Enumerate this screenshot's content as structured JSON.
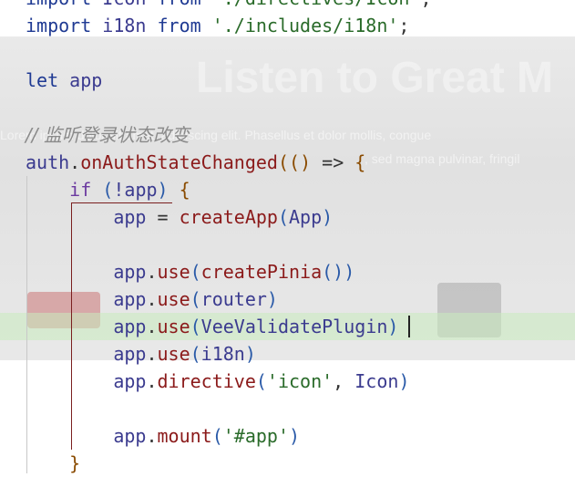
{
  "background": {
    "headline": "Listen to Great M",
    "subtitle_line1": "Lorem ipsum dolor sit amet, adipiscing elit. Phasellus et dolor mollis, congue",
    "subtitle_line2": ", sed magna pulvinar, fringil"
  },
  "code_lines": [
    {
      "tokens": [
        {
          "t": "import",
          "c": "kw"
        },
        {
          "t": " Icon ",
          "c": "ident"
        },
        {
          "t": "from",
          "c": "kw"
        },
        {
          "t": " ",
          "c": "op"
        },
        {
          "t": "'./directives/Icon'",
          "c": "str"
        },
        {
          "t": ";",
          "c": "op"
        }
      ]
    },
    {
      "tokens": [
        {
          "t": "import",
          "c": "kw"
        },
        {
          "t": " i18n ",
          "c": "ident"
        },
        {
          "t": "from",
          "c": "kw"
        },
        {
          "t": " ",
          "c": "op"
        },
        {
          "t": "'./includes/i18n'",
          "c": "str"
        },
        {
          "t": ";",
          "c": "op"
        }
      ]
    },
    {
      "tokens": []
    },
    {
      "tokens": [
        {
          "t": "let",
          "c": "kw"
        },
        {
          "t": " app",
          "c": "ident"
        }
      ]
    },
    {
      "tokens": []
    },
    {
      "tokens": [
        {
          "t": "// 监听登录状态改变",
          "c": "cmt"
        }
      ]
    },
    {
      "tokens": [
        {
          "t": "auth",
          "c": "ident"
        },
        {
          "t": ".",
          "c": "op"
        },
        {
          "t": "onAuthStateChanged",
          "c": "fn"
        },
        {
          "t": "((",
          "c": "paren"
        },
        {
          "t": ")",
          "c": "paren"
        },
        {
          "t": " => ",
          "c": "op"
        },
        {
          "t": "{",
          "c": "paren"
        }
      ]
    },
    {
      "tokens": [
        {
          "t": "    ",
          "c": "op"
        },
        {
          "t": "if",
          "c": "kw2"
        },
        {
          "t": " (",
          "c": "paren2"
        },
        {
          "t": "!app",
          "c": "ident"
        },
        {
          "t": ")",
          "c": "paren2"
        },
        {
          "t": " {",
          "c": "paren"
        }
      ]
    },
    {
      "tokens": [
        {
          "t": "        ",
          "c": "op"
        },
        {
          "t": "app",
          "c": "ident"
        },
        {
          "t": " = ",
          "c": "op"
        },
        {
          "t": "createApp",
          "c": "fn"
        },
        {
          "t": "(",
          "c": "paren2"
        },
        {
          "t": "App",
          "c": "ident"
        },
        {
          "t": ")",
          "c": "paren2"
        }
      ]
    },
    {
      "tokens": []
    },
    {
      "tokens": [
        {
          "t": "        ",
          "c": "op"
        },
        {
          "t": "app",
          "c": "ident"
        },
        {
          "t": ".",
          "c": "op"
        },
        {
          "t": "use",
          "c": "fn"
        },
        {
          "t": "(",
          "c": "paren2"
        },
        {
          "t": "createPinia",
          "c": "fn"
        },
        {
          "t": "())",
          "c": "paren2"
        }
      ]
    },
    {
      "tokens": [
        {
          "t": "        ",
          "c": "op"
        },
        {
          "t": "app",
          "c": "ident"
        },
        {
          "t": ".",
          "c": "op"
        },
        {
          "t": "use",
          "c": "fn"
        },
        {
          "t": "(",
          "c": "paren2"
        },
        {
          "t": "router",
          "c": "ident"
        },
        {
          "t": ")",
          "c": "paren2"
        }
      ]
    },
    {
      "tokens": [
        {
          "t": "        ",
          "c": "op"
        },
        {
          "t": "app",
          "c": "ident"
        },
        {
          "t": ".",
          "c": "op"
        },
        {
          "t": "use",
          "c": "fn"
        },
        {
          "t": "(",
          "c": "paren2"
        },
        {
          "t": "VeeValidatePlugin",
          "c": "ident"
        },
        {
          "t": ")",
          "c": "paren2"
        }
      ],
      "highlight": true
    },
    {
      "tokens": [
        {
          "t": "        ",
          "c": "op"
        },
        {
          "t": "app",
          "c": "ident"
        },
        {
          "t": ".",
          "c": "op"
        },
        {
          "t": "use",
          "c": "fn"
        },
        {
          "t": "(",
          "c": "paren2"
        },
        {
          "t": "i18n",
          "c": "ident"
        },
        {
          "t": ")",
          "c": "paren2"
        }
      ]
    },
    {
      "tokens": [
        {
          "t": "        ",
          "c": "op"
        },
        {
          "t": "app",
          "c": "ident"
        },
        {
          "t": ".",
          "c": "op"
        },
        {
          "t": "directive",
          "c": "fn"
        },
        {
          "t": "(",
          "c": "paren2"
        },
        {
          "t": "'icon'",
          "c": "str"
        },
        {
          "t": ", ",
          "c": "op"
        },
        {
          "t": "Icon",
          "c": "ident"
        },
        {
          "t": ")",
          "c": "paren2"
        }
      ]
    },
    {
      "tokens": []
    },
    {
      "tokens": [
        {
          "t": "        ",
          "c": "op"
        },
        {
          "t": "app",
          "c": "ident"
        },
        {
          "t": ".",
          "c": "op"
        },
        {
          "t": "mount",
          "c": "fn"
        },
        {
          "t": "(",
          "c": "paren2"
        },
        {
          "t": "'#app'",
          "c": "str"
        },
        {
          "t": ")",
          "c": "paren2"
        }
      ]
    },
    {
      "tokens": [
        {
          "t": "    ",
          "c": "op"
        },
        {
          "t": "}",
          "c": "paren"
        }
      ]
    }
  ],
  "colors": {
    "keyword": "#1f3a93",
    "function": "#8b1a1a",
    "string": "#2a6b2a",
    "comment": "#8a8a8a",
    "highlight_line": "#c8ebbe"
  }
}
